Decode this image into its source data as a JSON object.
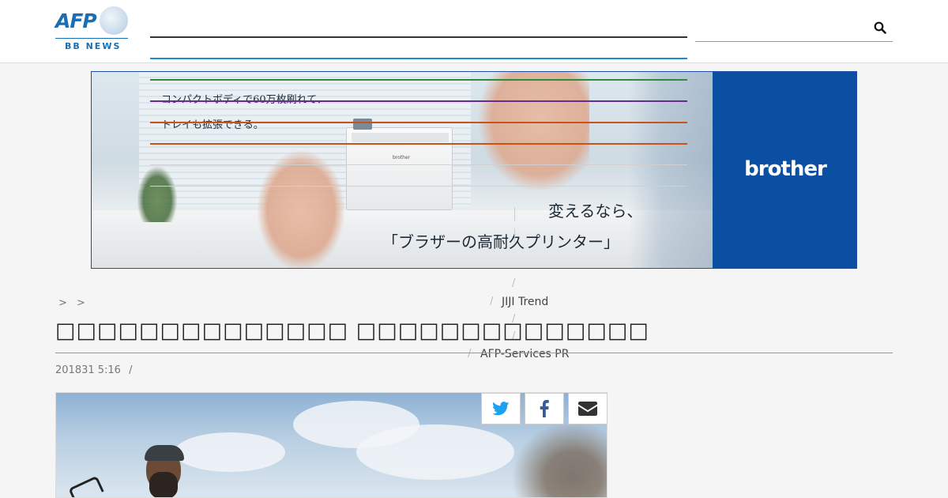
{
  "header": {
    "logo_text": "AFP",
    "logo_sub": "BB NEWS",
    "search": {
      "placeholder": "",
      "value": ""
    }
  },
  "ad": {
    "copy_line1": "コンパクトボディで60万枚刷れて、",
    "copy_line2": "トレイも拡張できる。",
    "headline_line1": "変えるなら、",
    "headline_line2": "「ブラザーの高耐久プリンター」",
    "brand": "brother",
    "printer_label": "brother",
    "colors": {
      "brand_panel": "#0b4fa2"
    }
  },
  "menu": {
    "bar_colors": [
      "#333333",
      "#1a8fd0",
      "#2e8b3a",
      "#6b2a90",
      "#c9541a",
      "#c9541a"
    ],
    "items": [
      {
        "label": "JIJI Trend"
      },
      {
        "label": "AFP-Services PR"
      }
    ],
    "separator": "/"
  },
  "breadcrumb": {
    "items": [
      ">",
      ">"
    ]
  },
  "article": {
    "title": "□□□□□□□□□□□□□□ □□□□□□□□□□□□□□",
    "meta": "201831 5:16",
    "meta_sep": "/"
  },
  "share": {
    "buttons": [
      {
        "icon": "twitter-icon",
        "color": "#1da1f2"
      },
      {
        "icon": "facebook-icon",
        "color": "#3b5998"
      },
      {
        "icon": "email-icon",
        "color": "#333333"
      }
    ]
  }
}
